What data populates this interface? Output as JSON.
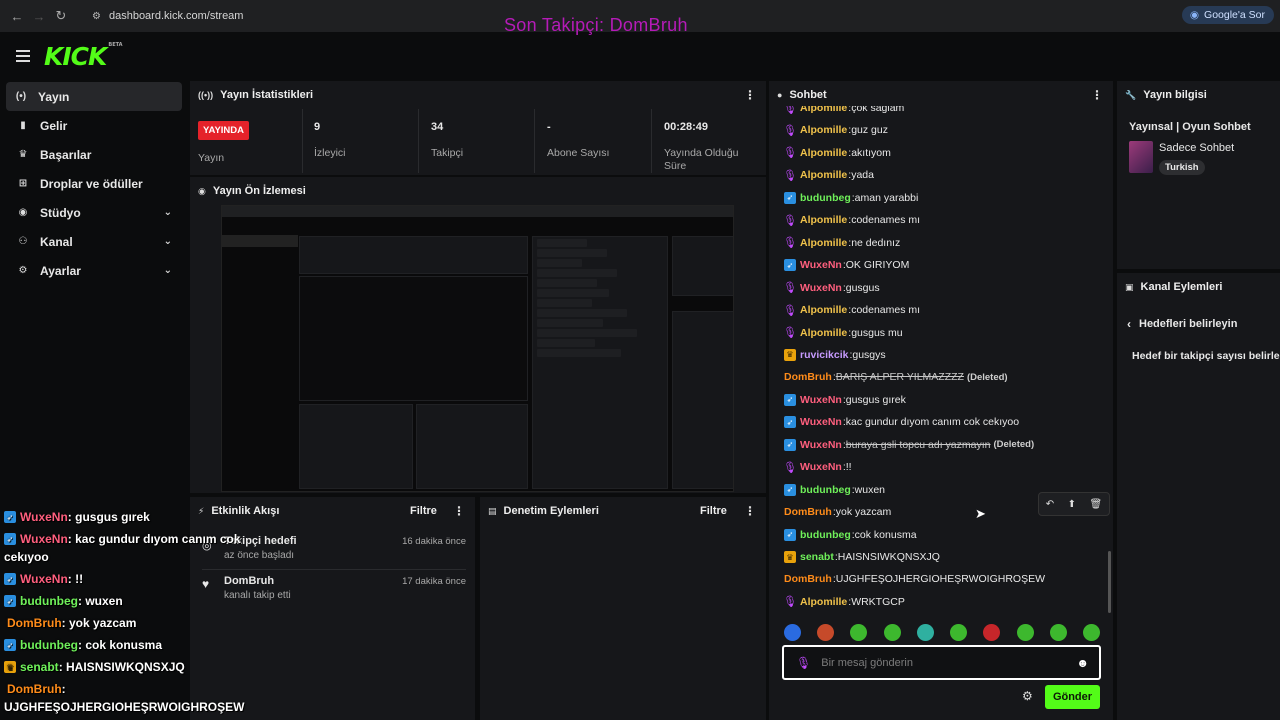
{
  "browser": {
    "url": "dashboard.kick.com/stream",
    "google_btn": "Google'a Sor"
  },
  "overlay_title": "Son Takipçi: DomBruh",
  "logo": {
    "text": "KICK",
    "beta": "BETA"
  },
  "sidebar": {
    "items": [
      {
        "label": "Yayın",
        "icon": "broadcast-icon",
        "active": true
      },
      {
        "label": "Gelir",
        "icon": "chart-icon"
      },
      {
        "label": "Başarılar",
        "icon": "trophy-icon"
      },
      {
        "label": "Droplar ve ödüller",
        "icon": "gift-icon"
      },
      {
        "label": "Stüdyo",
        "icon": "camera-icon",
        "chevron": true
      },
      {
        "label": "Kanal",
        "icon": "users-icon",
        "chevron": true
      },
      {
        "label": "Ayarlar",
        "icon": "gear-icon",
        "chevron": true
      }
    ]
  },
  "stats": {
    "title": "Yayın İstatistikleri",
    "live_badge": "YAYINDA",
    "items": [
      {
        "value": "",
        "label": "Yayın"
      },
      {
        "value": "9",
        "label": "İzleyici"
      },
      {
        "value": "34",
        "label": "Takipçi"
      },
      {
        "value": "-",
        "label": "Abone Sayısı"
      },
      {
        "value": "00:28:49",
        "label": "Yayında Olduğu Süre"
      }
    ]
  },
  "preview": {
    "title": "Yayın Ön İzlemesi"
  },
  "activity": {
    "title": "Etkinlik Akışı",
    "filter": "Filtre",
    "items": [
      {
        "title": "Takipçi hedefi",
        "sub": "az önce başladı",
        "time": "16 dakika önce"
      },
      {
        "title": "DomBruh",
        "sub": "kanalı takip etti",
        "time": "17 dakika önce"
      }
    ]
  },
  "moderation": {
    "title": "Denetim Eylemleri",
    "filter": "Filtre"
  },
  "chat": {
    "title": "Sohbet",
    "messages": [
      {
        "user": "Alpomille",
        "badge": "mic",
        "color": "#f0c24b",
        "text": "çok sağlam"
      },
      {
        "user": "Alpomille",
        "badge": "mic",
        "color": "#f0c24b",
        "text": "guz guz"
      },
      {
        "user": "Alpomille",
        "badge": "mic",
        "color": "#f0c24b",
        "text": "akıtıyom"
      },
      {
        "user": "Alpomille",
        "badge": "mic",
        "color": "#f0c24b",
        "text": "yada"
      },
      {
        "user": "budunbeg",
        "badge": "fish",
        "color": "#6ff05a",
        "text": "aman yarabbi"
      },
      {
        "user": "Alpomille",
        "badge": "mic",
        "color": "#f0c24b",
        "text": "codenames mı"
      },
      {
        "user": "Alpomille",
        "badge": "mic",
        "color": "#f0c24b",
        "text": "ne dedınız"
      },
      {
        "user": "WuxeNn",
        "badge": "fish",
        "color": "#ff5f7e",
        "text": "OK GIRIYOM"
      },
      {
        "user": "WuxeNn",
        "badge": "mic",
        "color": "#ff5f7e",
        "text": "gusgus"
      },
      {
        "user": "Alpomille",
        "badge": "mic",
        "color": "#f0c24b",
        "text": "codenames mı"
      },
      {
        "user": "Alpomille",
        "badge": "mic",
        "color": "#f0c24b",
        "text": "gusgus mu"
      },
      {
        "user": "ruvicikcik",
        "badge": "crown",
        "color": "#c79bff",
        "text": "gusgys"
      },
      {
        "user": "DomBruh",
        "badge": "",
        "color": "#ff8c1a",
        "text": "BARIŞ ALPER YILMAZZZZ",
        "deleted": true
      },
      {
        "user": "WuxeNn",
        "badge": "fish",
        "color": "#ff5f7e",
        "text": "gusgus gırek"
      },
      {
        "user": "WuxeNn",
        "badge": "fish",
        "color": "#ff5f7e",
        "text": "kac gundur dıyom canım cok cekıyoo"
      },
      {
        "user": "WuxeNn",
        "badge": "fish",
        "color": "#ff5f7e",
        "text": "buraya gsli topcu adı yazmayın",
        "deleted": true
      },
      {
        "user": "WuxeNn",
        "badge": "mic",
        "color": "#ff5f7e",
        "text": "!!"
      },
      {
        "user": "budunbeg",
        "badge": "fish",
        "color": "#6ff05a",
        "text": "wuxen"
      },
      {
        "user": "DomBruh",
        "badge": "",
        "color": "#ff8c1a",
        "text": "yok yazcam"
      },
      {
        "user": "budunbeg",
        "badge": "fish",
        "color": "#6ff05a",
        "text": "cok konusma"
      },
      {
        "user": "senabt",
        "badge": "crown",
        "color": "#6ff05a",
        "text": "HAISNSIWKQNSXJQ"
      },
      {
        "user": "DomBruh",
        "badge": "",
        "color": "#ff8c1a",
        "text": "UJGHFEŞOJHERGIOHEŞRWOIGHROŞEW"
      },
      {
        "user": "Alpomille",
        "badge": "mic",
        "color": "#f0c24b",
        "text": "WRKTGCP"
      }
    ],
    "deleted_tag": "(Deleted)",
    "input_placeholder": "Bir mesaj gönderin",
    "send": "Gönder"
  },
  "overlay_chat": [
    {
      "user": "WuxeNn",
      "badge": "fish",
      "color": "#ff5f7e",
      "text": " : gusgus gırek"
    },
    {
      "user": "WuxeNn",
      "badge": "fish",
      "color": "#ff5f7e",
      "text": " : kac gundur dıyom canım cok"
    },
    {
      "user": "",
      "badge": "",
      "color": "#ffffff",
      "text": "cekıyoo"
    },
    {
      "user": "WuxeNn",
      "badge": "fish",
      "color": "#ff5f7e",
      "text": " : !!"
    },
    {
      "user": "budunbeg",
      "badge": "fish",
      "color": "#6ff05a",
      "text": " : wuxen"
    },
    {
      "user": "DomBruh",
      "badge": "",
      "color": "#ff8c1a",
      "text": " : yok yazcam"
    },
    {
      "user": "budunbeg",
      "badge": "fish",
      "color": "#6ff05a",
      "text": " : cok konusma"
    },
    {
      "user": "senabt",
      "badge": "crown",
      "color": "#6ff05a",
      "text": " : HAISNSIWKQNSXJQ"
    },
    {
      "user": "DomBruh",
      "badge": "",
      "color": "#ff8c1a",
      "text": " :"
    },
    {
      "user": "",
      "badge": "",
      "color": "#ffffff",
      "text": "UJGHFEŞOJHERGIOHEŞRWOIGHROŞEW"
    }
  ],
  "stream_info": {
    "title": "Yayın bilgisi",
    "stream_title": "Yayınsal | Oyun Sohbet",
    "category": "Sadece Sohbet",
    "language": "Turkish"
  },
  "channel_actions": {
    "title": "Kanal Eylemleri",
    "back_label": "Hedefleri belirleyin",
    "desc": "Hedef bir takipçi sayısı belirle."
  },
  "colors": {
    "accent": "#53fc18",
    "live": "#e5222a",
    "panel": "#16171a",
    "overlay": "#b51bb8"
  }
}
